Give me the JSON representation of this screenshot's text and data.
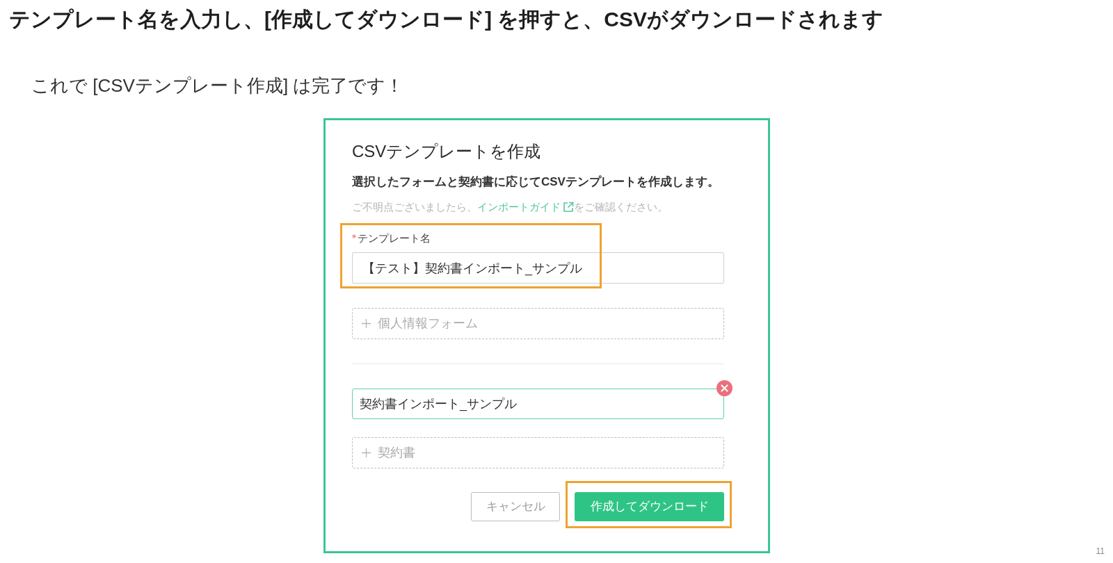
{
  "heading": "テンプレート名を入力し、[作成してダウンロード] を押すと、CSVがダウンロードされます",
  "intro": "これで [CSVテンプレート作成] は完了です！",
  "screenshot": {
    "title": "CSVテンプレートを作成",
    "description": "選択したフォームと契約書に応じてCSVテンプレートを作成します。",
    "help": {
      "before": "ご不明点ございましたら、",
      "link": "インポートガイド",
      "after": "をご確認ください。"
    },
    "template_name": {
      "label": "テンプレート名",
      "required": true,
      "value": "【テスト】契約書インポート_サンプル",
      "highlighted": true
    },
    "form_slots": [
      {
        "kind": "add",
        "label": "個人情報フォーム"
      }
    ],
    "contract_slots": [
      {
        "kind": "selected",
        "value": "契約書インポート_サンプル"
      },
      {
        "kind": "add",
        "label": "契約書"
      }
    ],
    "buttons": [
      {
        "kind": "secondary",
        "label": "キャンセル",
        "highlighted": false
      },
      {
        "kind": "primary",
        "label": "作成してダウンロード",
        "highlighted": true
      }
    ]
  },
  "page_number": "11"
}
